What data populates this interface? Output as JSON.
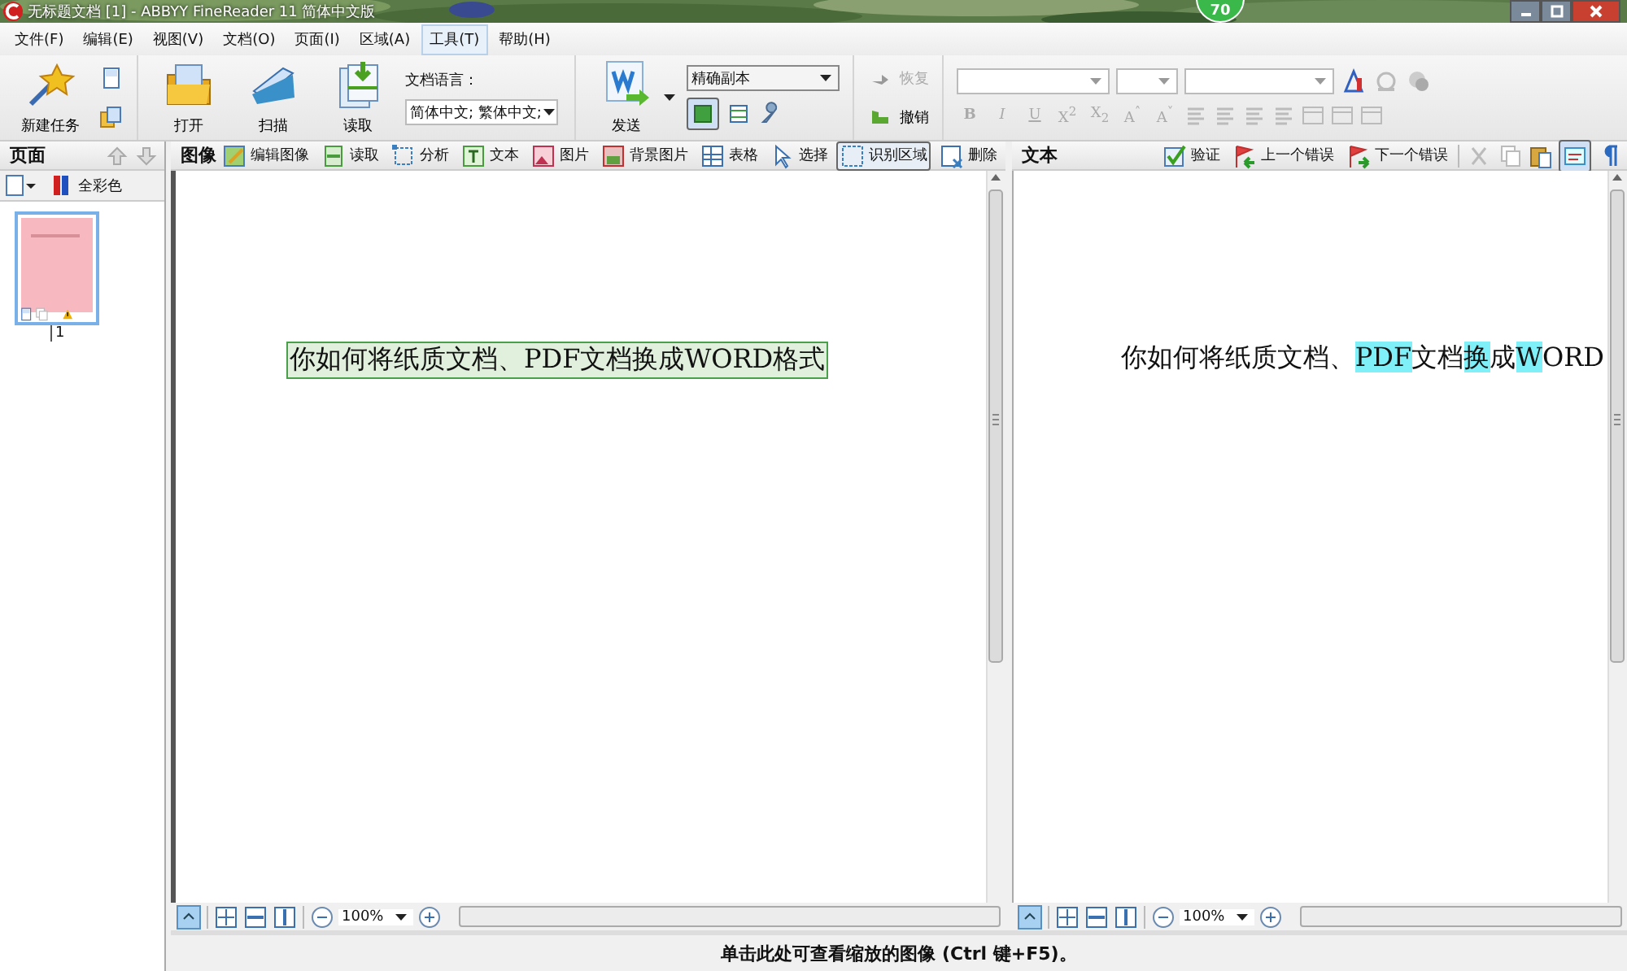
{
  "window": {
    "title": "无标题文档 [1] - ABBYY FineReader 11 简体中文版",
    "badge": "70"
  },
  "menu": [
    {
      "label": "文件(F)",
      "selected": false
    },
    {
      "label": "编辑(E)",
      "selected": false
    },
    {
      "label": "视图(V)",
      "selected": false
    },
    {
      "label": "文档(O)",
      "selected": false
    },
    {
      "label": "页面(I)",
      "selected": false
    },
    {
      "label": "区域(A)",
      "selected": false
    },
    {
      "label": "工具(T)",
      "selected": true
    },
    {
      "label": "帮助(H)",
      "selected": false
    }
  ],
  "toolbar": {
    "new_task": "新建任务",
    "open": "打开",
    "scan": "扫描",
    "read": "读取",
    "language_label": "文档语言：",
    "language": "简体中文; 繁体中文;",
    "send": "发送",
    "mode": "精确副本",
    "view_toggles": [
      {
        "selected": true
      },
      {
        "selected": false
      }
    ],
    "history": [
      {
        "label": "恢复",
        "disabled": true
      },
      {
        "label": "撤销",
        "disabled": false
      }
    ],
    "format_buttons": [
      "B",
      "I",
      "U",
      "X$^{2}$",
      "X$_{2}$",
      "A$^{˄}$",
      "A$^{˅}$"
    ]
  },
  "pages_panel": {
    "title": "页面",
    "color_mode": "全彩色",
    "pages": [
      {
        "number": "1",
        "selected": true,
        "warning": true
      }
    ]
  },
  "image_panel": {
    "title": "图像",
    "tools": [
      {
        "label": "编辑图像",
        "selected": false
      },
      {
        "label": "读取",
        "selected": false
      },
      {
        "label": "分析",
        "selected": false
      },
      {
        "label": "文本",
        "selected": false
      },
      {
        "label": "图片",
        "selected": false
      },
      {
        "label": "背景图片",
        "selected": false
      },
      {
        "label": "表格",
        "selected": false
      },
      {
        "label": "选择",
        "selected": false
      },
      {
        "label": "识别区域",
        "selected": true
      },
      {
        "label": "删除",
        "selected": false
      }
    ],
    "region_text": "你如何将纸质文档、PDF文档换成WORD格式",
    "zoom": "100%"
  },
  "text_panel": {
    "title": "文本",
    "tools": [
      "验证",
      "上一个错误",
      "下一个错误"
    ],
    "show_format_selected": true,
    "segments": [
      {
        "text": "你如何将纸质文档、",
        "flagged": false
      },
      {
        "text": "PDF",
        "flagged": true
      },
      {
        "text": "文档",
        "flagged": false
      },
      {
        "text": "换",
        "flagged": true
      },
      {
        "text": "成",
        "flagged": false
      },
      {
        "text": "W",
        "flagged": true
      },
      {
        "text": "ORD",
        "flagged": false
      }
    ],
    "zoom": "100%"
  },
  "status_bar": "单击此处可查看缩放的图像 (Ctrl 键+F5)。"
}
